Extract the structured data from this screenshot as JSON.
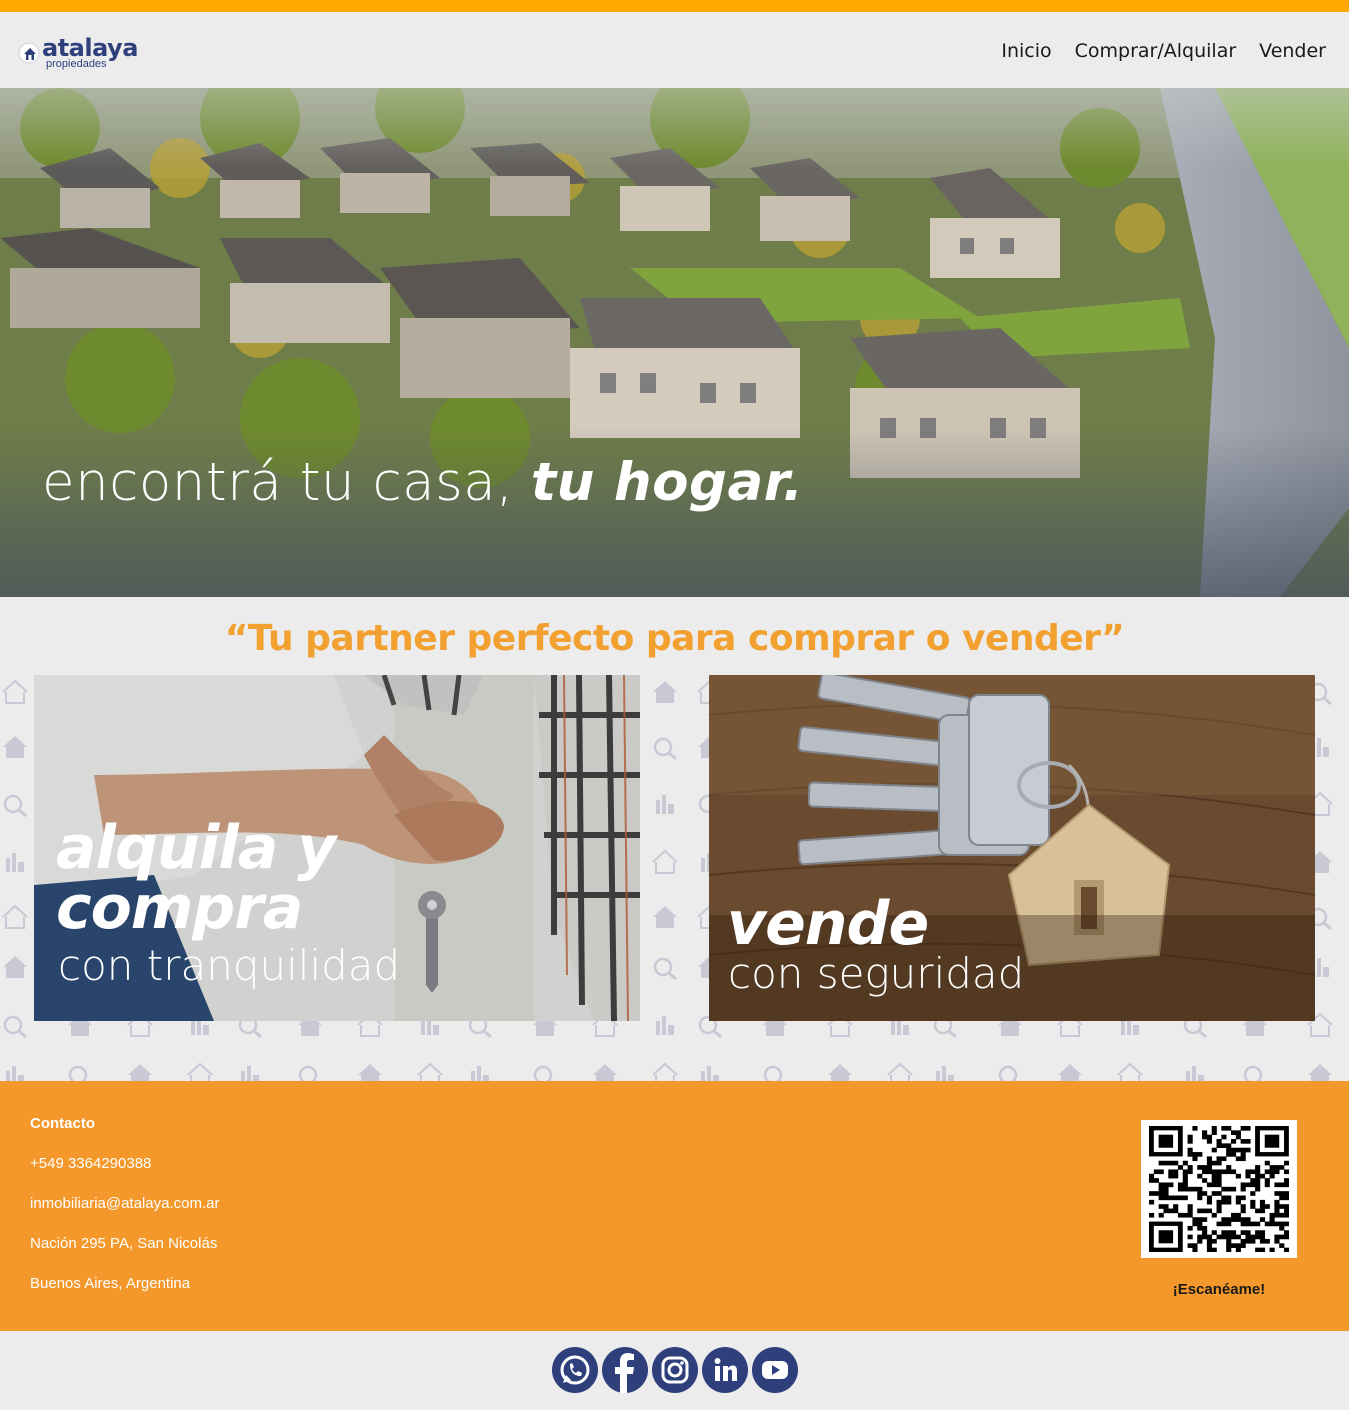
{
  "brand": {
    "name": "atalaya",
    "sub": "propiedades",
    "accent": "#ffa800",
    "orange": "#f4982b",
    "navy": "#2e3f7c"
  },
  "nav": {
    "items": [
      {
        "label": "Inicio"
      },
      {
        "label": "Comprar/Alquilar"
      },
      {
        "label": "Vender"
      }
    ]
  },
  "hero": {
    "text_light": "encontrá tu casa, ",
    "text_bold": "tu hogar."
  },
  "tagline": {
    "q_open": "“Tu ",
    "w1": "partner",
    "t1": " perfecto para ",
    "w2": "comprar",
    "t2": " o ",
    "w3": "vender",
    "q_close": "”"
  },
  "cards": {
    "left": {
      "big1": "alquila y",
      "big2": "compra",
      "small": "con tranquilidad"
    },
    "right": {
      "big": "vende",
      "small": "con seguridad"
    }
  },
  "contact": {
    "title": "Contacto",
    "phone": "+549 3364290388",
    "email": "inmobiliaria@atalaya.com.ar",
    "address": "Nación 295 PA, San Nicolás",
    "region": "Buenos Aires, Argentina"
  },
  "qr": {
    "caption": "¡Escanéame!"
  },
  "socials": [
    {
      "icon": "whatsapp-icon"
    },
    {
      "icon": "facebook-icon"
    },
    {
      "icon": "instagram-icon"
    },
    {
      "icon": "linkedin-icon"
    },
    {
      "icon": "youtube-icon"
    }
  ]
}
